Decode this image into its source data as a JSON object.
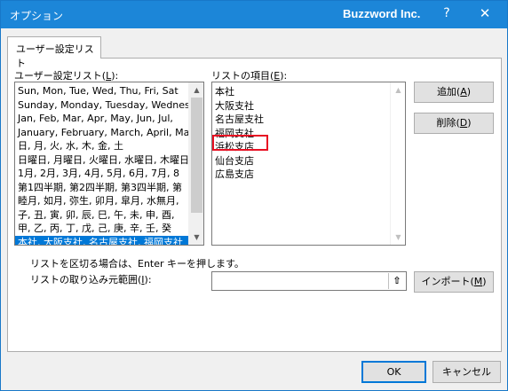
{
  "window": {
    "title": "オプション",
    "brand": "Buzzword Inc.",
    "help_label": "?",
    "close_label": "✕"
  },
  "tab": {
    "label": "ユーザー設定リスト"
  },
  "custom_lists": {
    "label_prefix": "ユーザー設定リスト(",
    "label_key": "L",
    "label_suffix": "):",
    "items": [
      "Sun, Mon, Tue, Wed, Thu, Fri, Sat",
      "Sunday, Monday, Tuesday, Wednesday",
      "Jan, Feb, Mar, Apr, May, Jun, Jul,",
      "January, February, March, April, May",
      "日, 月, 火, 水, 木, 金, 土",
      "日曜日, 月曜日, 火曜日, 水曜日, 木曜日",
      "1月, 2月, 3月, 4月, 5月, 6月, 7月, 8",
      "第1四半期, 第2四半期, 第3四半期, 第",
      "睦月, 如月, 弥生, 卯月, 皐月, 水無月,",
      "子, 丑, 寅, 卯, 辰, 巳, 午, 未, 申, 酉,",
      "甲, 乙, 丙, 丁, 戊, 己, 庚, 辛, 壬, 癸",
      "本社, 大阪支社, 名古屋支社, 福岡支社"
    ],
    "selected_index": 11
  },
  "list_entries": {
    "label_prefix": "リストの項目(",
    "label_key": "E",
    "label_suffix": "):",
    "lines": [
      "本社",
      "大阪支社",
      "名古屋支社",
      "福岡支社",
      "浜松支店",
      "仙台支店",
      "広島支店"
    ]
  },
  "buttons": {
    "add_prefix": "追加(",
    "add_key": "A",
    "add_suffix": ")",
    "delete_prefix": "削除(",
    "delete_key": "D",
    "delete_suffix": ")",
    "import_prefix": "インポート(",
    "import_key": "M",
    "import_suffix": ")",
    "ok": "OK",
    "cancel": "キャンセル"
  },
  "hint": "リストを区切る場合は、Enter キーを押します。",
  "import_range": {
    "label_prefix": "リストの取り込み元範囲(",
    "label_key": "I",
    "label_suffix": "):",
    "value": "",
    "collapse_glyph": "⇧"
  },
  "icons": {
    "collapse": "collapse-dialog-icon",
    "scroll_up": "scroll-up-icon",
    "scroll_down": "scroll-down-icon"
  }
}
